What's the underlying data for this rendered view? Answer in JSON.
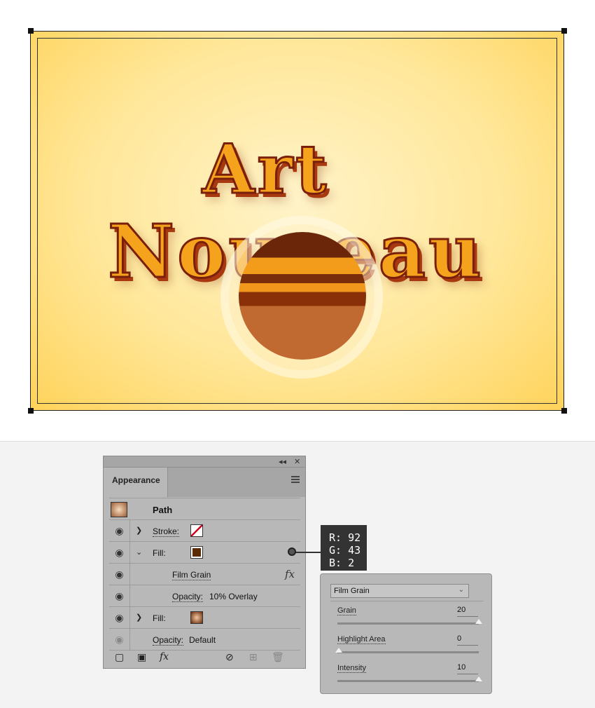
{
  "artwork": {
    "line1": "Art",
    "line2": "Nouveau"
  },
  "panel": {
    "tab_label": "Appearance",
    "collapse_icon": "◂◂",
    "close_icon": "✕",
    "object_label": "Path",
    "rows": [
      {
        "label": "Stroke:",
        "visible": true,
        "expanded": false
      },
      {
        "label": "Fill:",
        "visible": true,
        "expanded": true,
        "color": "#5c2b02"
      },
      {
        "label": "Film Grain"
      },
      {
        "label": "Opacity:",
        "value": "10% Overlay"
      },
      {
        "label": "Fill:",
        "visible": true,
        "expanded": false
      },
      {
        "label": "Opacity:",
        "value": "Default"
      }
    ],
    "fx_icon_text": "fx"
  },
  "tooltip": {
    "r": "R: 92",
    "g": "G: 43",
    "b": "B: 2"
  },
  "film_grain": {
    "effect": "Film Grain",
    "grain": {
      "label": "Grain",
      "value": "20",
      "level": 1.0
    },
    "highlight": {
      "label": "Highlight Area",
      "value": "0",
      "level": 0.0
    },
    "intensity": {
      "label": "Intensity",
      "value": "10",
      "level": 1.0
    }
  }
}
